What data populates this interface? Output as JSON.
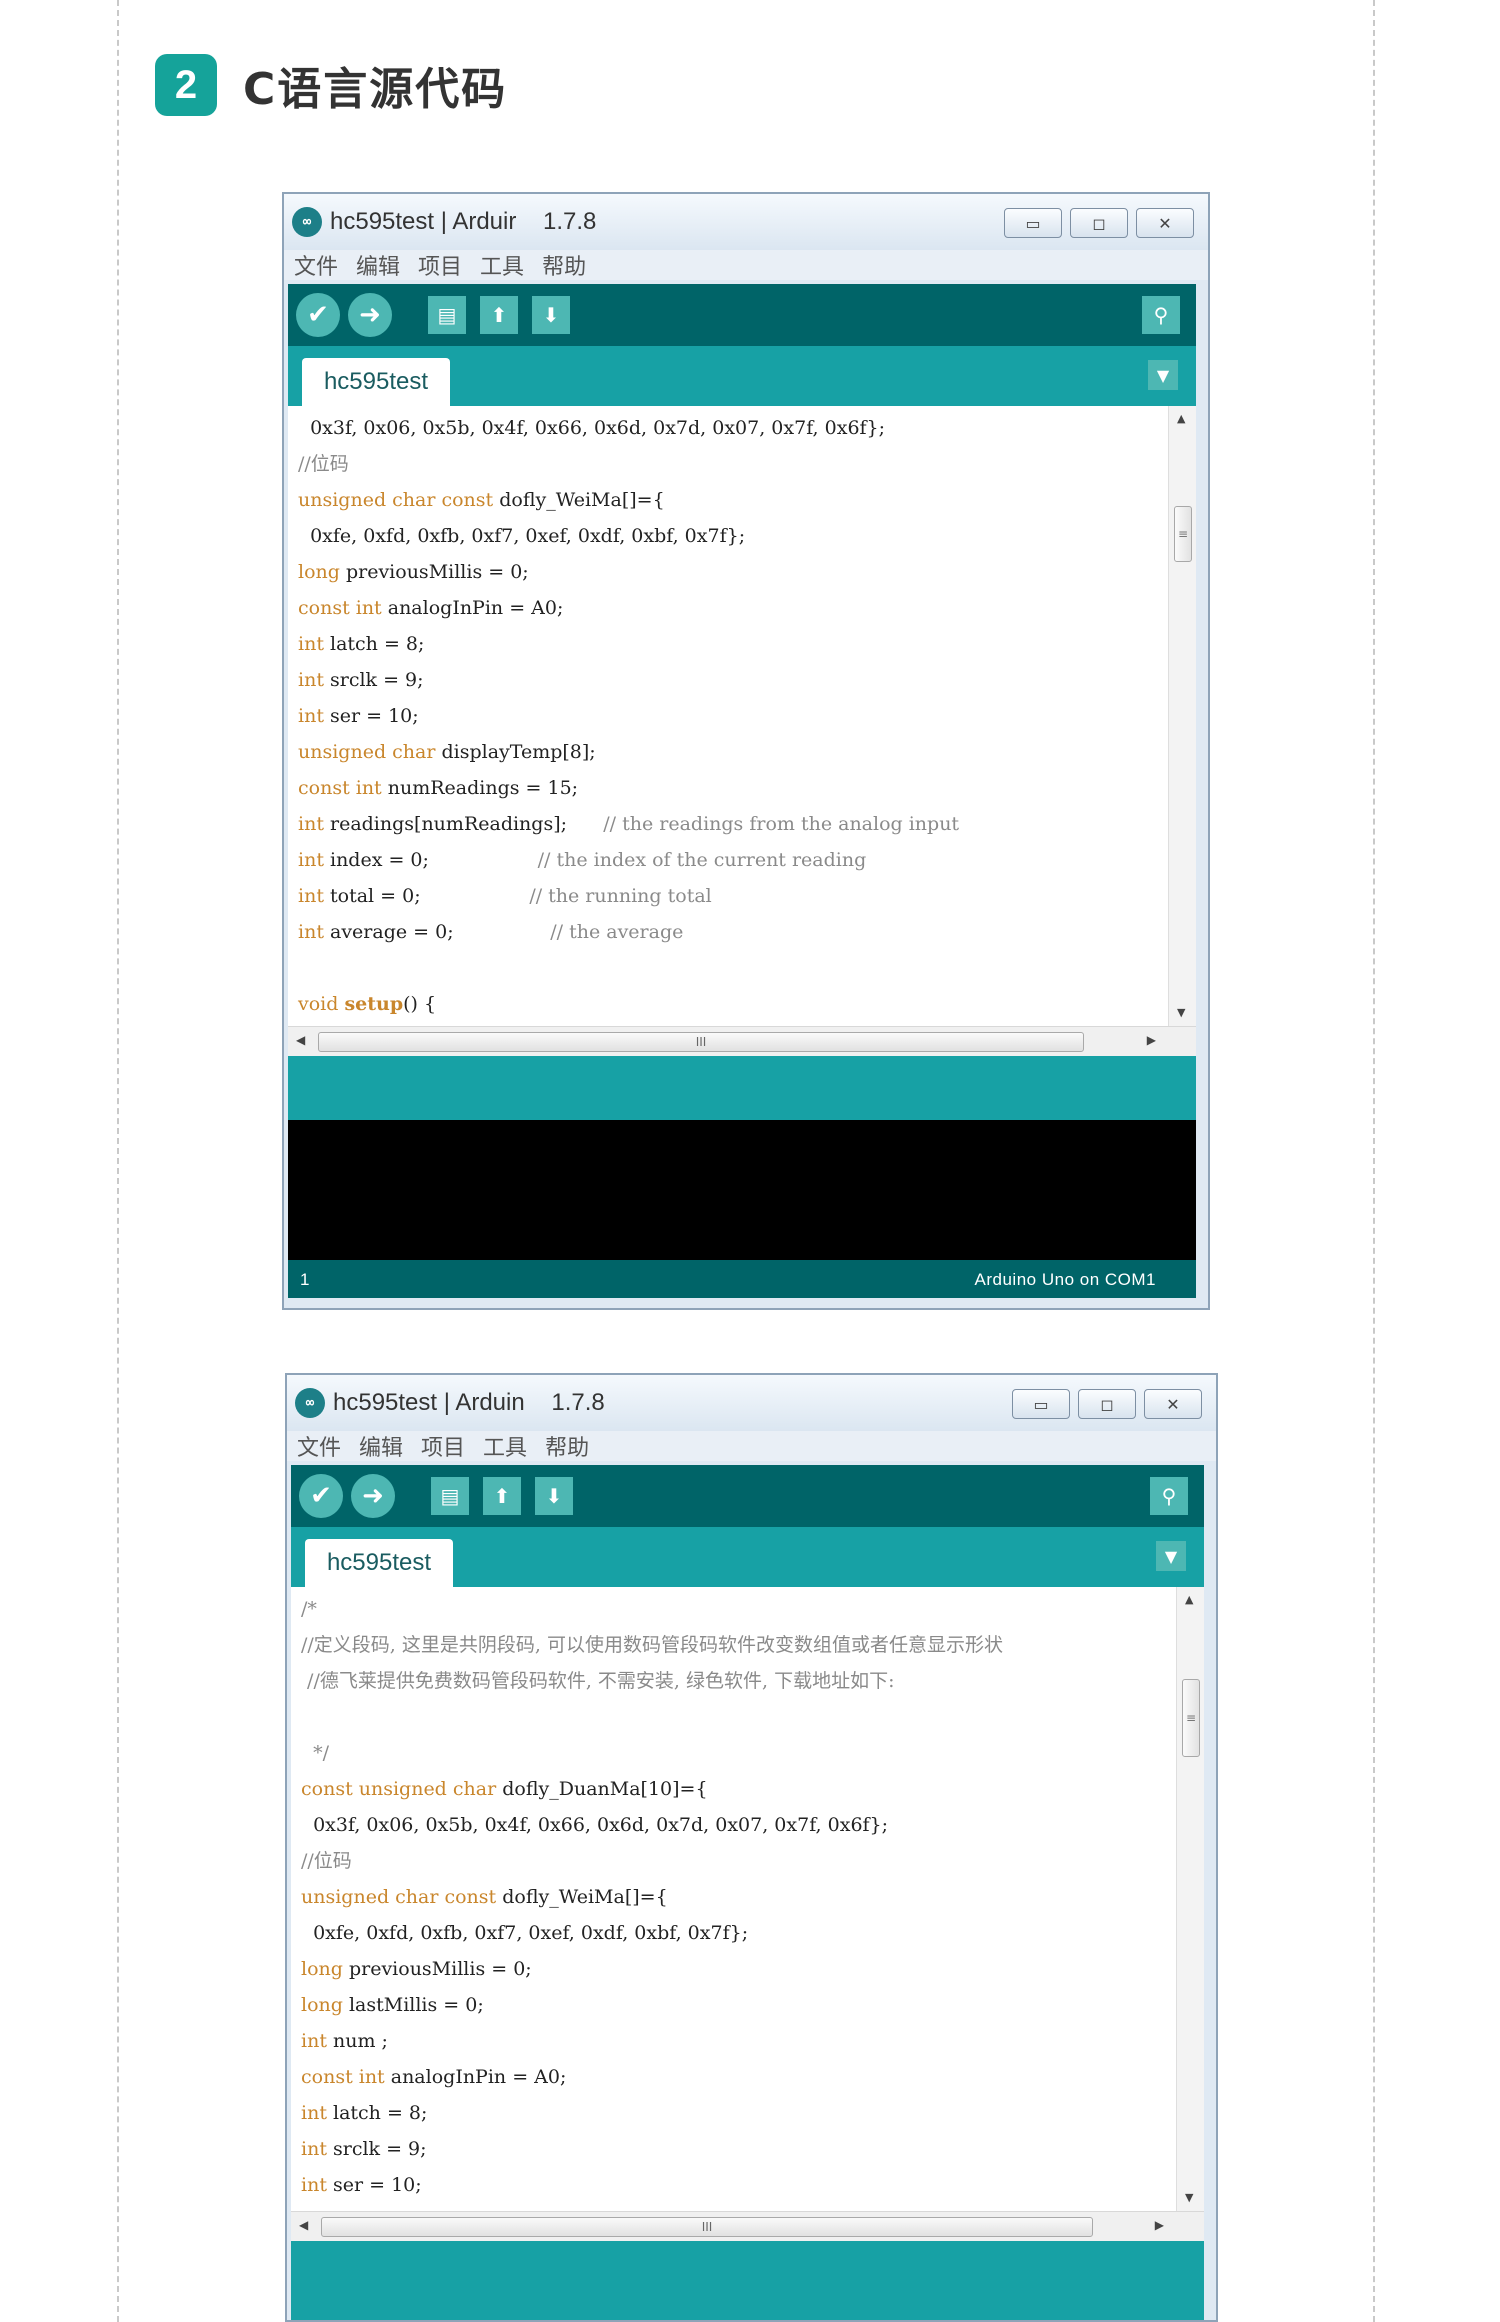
{
  "section": {
    "number": "2",
    "title": "C语言源代码"
  },
  "icons": {
    "app": "arduino-logo-icon",
    "verify": "check-icon",
    "upload": "arrow-right-icon",
    "new": "file-icon",
    "open": "upload-icon",
    "save": "download-icon",
    "serial": "magnifier-icon",
    "tab_menu": "triangle-down-icon"
  },
  "colors": {
    "teal_dark": "#006468",
    "teal": "#17a1a5",
    "accent": "#15a39a",
    "keyword": "#c9862c",
    "comment": "#8a8a8a"
  },
  "windows": [
    {
      "title": "hc595test | Arduir",
      "version": "1.7.8",
      "menu": [
        "文件",
        "编辑",
        "项目",
        "工具",
        "帮助"
      ],
      "tab": "hc595test",
      "scroll_h_label": "III",
      "status_line": "1",
      "status_board": "Arduino Uno on COM1",
      "code": [
        [
          {
            "t": "  0x3f, 0x06, 0x5b, 0x4f, 0x66, 0x6d, 0x7d, 0x07, 0x7f, 0x6f};",
            "c": ""
          }
        ],
        [
          {
            "t": "//位码",
            "c": "cm"
          }
        ],
        [
          {
            "t": "unsigned char const",
            "c": "kw"
          },
          {
            "t": " dofly_WeiMa[]={",
            "c": ""
          }
        ],
        [
          {
            "t": "  0xfe, 0xfd, 0xfb, 0xf7, 0xef, 0xdf, 0xbf, 0x7f};",
            "c": ""
          }
        ],
        [
          {
            "t": "long",
            "c": "kw"
          },
          {
            "t": " previousMillis = 0;",
            "c": ""
          }
        ],
        [
          {
            "t": "const int",
            "c": "kw"
          },
          {
            "t": " analogInPin = A0;",
            "c": ""
          }
        ],
        [
          {
            "t": "int",
            "c": "kw"
          },
          {
            "t": " latch = 8;",
            "c": ""
          }
        ],
        [
          {
            "t": "int",
            "c": "kw"
          },
          {
            "t": " srclk = 9;",
            "c": ""
          }
        ],
        [
          {
            "t": "int",
            "c": "kw"
          },
          {
            "t": " ser = 10;",
            "c": ""
          }
        ],
        [
          {
            "t": "unsigned char",
            "c": "kw"
          },
          {
            "t": " displayTemp[8];",
            "c": ""
          }
        ],
        [
          {
            "t": "const int",
            "c": "kw"
          },
          {
            "t": " numReadings = 15;",
            "c": ""
          }
        ],
        [
          {
            "t": "int",
            "c": "kw"
          },
          {
            "t": " readings[numReadings];      ",
            "c": ""
          },
          {
            "t": "// the readings from the analog input",
            "c": "cm"
          }
        ],
        [
          {
            "t": "int",
            "c": "kw"
          },
          {
            "t": " index = 0;                  ",
            "c": ""
          },
          {
            "t": "// the index of the current reading",
            "c": "cm"
          }
        ],
        [
          {
            "t": "int",
            "c": "kw"
          },
          {
            "t": " total = 0;                  ",
            "c": ""
          },
          {
            "t": "// the running total",
            "c": "cm"
          }
        ],
        [
          {
            "t": "int",
            "c": "kw"
          },
          {
            "t": " average = 0;                ",
            "c": ""
          },
          {
            "t": "// the average",
            "c": "cm"
          }
        ],
        [
          {
            "t": "",
            "c": ""
          }
        ],
        [
          {
            "t": "void",
            "c": "kw"
          },
          {
            "t": " ",
            "c": ""
          },
          {
            "t": "setup",
            "c": "fn"
          },
          {
            "t": "() {",
            "c": ""
          }
        ]
      ]
    },
    {
      "title": "hc595test | Arduin",
      "version": "1.7.8",
      "menu": [
        "文件",
        "编辑",
        "项目",
        "工具",
        "帮助"
      ],
      "tab": "hc595test",
      "scroll_h_label": "III",
      "code": [
        [
          {
            "t": "/*",
            "c": "cm"
          }
        ],
        [
          {
            "t": "//定义段码, 这里是共阴段码, 可以使用数码管段码软件改变数组值或者任意显示形状",
            "c": "cm"
          }
        ],
        [
          {
            "t": " //德飞莱提供免费数码管段码软件, 不需安装, 绿色软件, 下载地址如下:",
            "c": "cm"
          }
        ],
        [
          {
            "t": "",
            "c": ""
          }
        ],
        [
          {
            "t": "  */",
            "c": "cm"
          }
        ],
        [
          {
            "t": "const unsigned char",
            "c": "kw"
          },
          {
            "t": " dofly_DuanMa[10]={",
            "c": ""
          }
        ],
        [
          {
            "t": "  0x3f, 0x06, 0x5b, 0x4f, 0x66, 0x6d, 0x7d, 0x07, 0x7f, 0x6f};",
            "c": ""
          }
        ],
        [
          {
            "t": "//位码",
            "c": "cm"
          }
        ],
        [
          {
            "t": "unsigned char const",
            "c": "kw"
          },
          {
            "t": " dofly_WeiMa[]={",
            "c": ""
          }
        ],
        [
          {
            "t": "  0xfe, 0xfd, 0xfb, 0xf7, 0xef, 0xdf, 0xbf, 0x7f};",
            "c": ""
          }
        ],
        [
          {
            "t": "long",
            "c": "kw"
          },
          {
            "t": " previousMillis = 0;",
            "c": ""
          }
        ],
        [
          {
            "t": "long",
            "c": "kw"
          },
          {
            "t": " lastMillis = 0;",
            "c": ""
          }
        ],
        [
          {
            "t": "int",
            "c": "kw"
          },
          {
            "t": " num ;",
            "c": ""
          }
        ],
        [
          {
            "t": "const int",
            "c": "kw"
          },
          {
            "t": " analogInPin = A0;",
            "c": ""
          }
        ],
        [
          {
            "t": "int",
            "c": "kw"
          },
          {
            "t": " latch = 8;",
            "c": ""
          }
        ],
        [
          {
            "t": "int",
            "c": "kw"
          },
          {
            "t": " srclk = 9;",
            "c": ""
          }
        ],
        [
          {
            "t": "int",
            "c": "kw"
          },
          {
            "t": " ser = 10;",
            "c": ""
          }
        ]
      ]
    }
  ]
}
